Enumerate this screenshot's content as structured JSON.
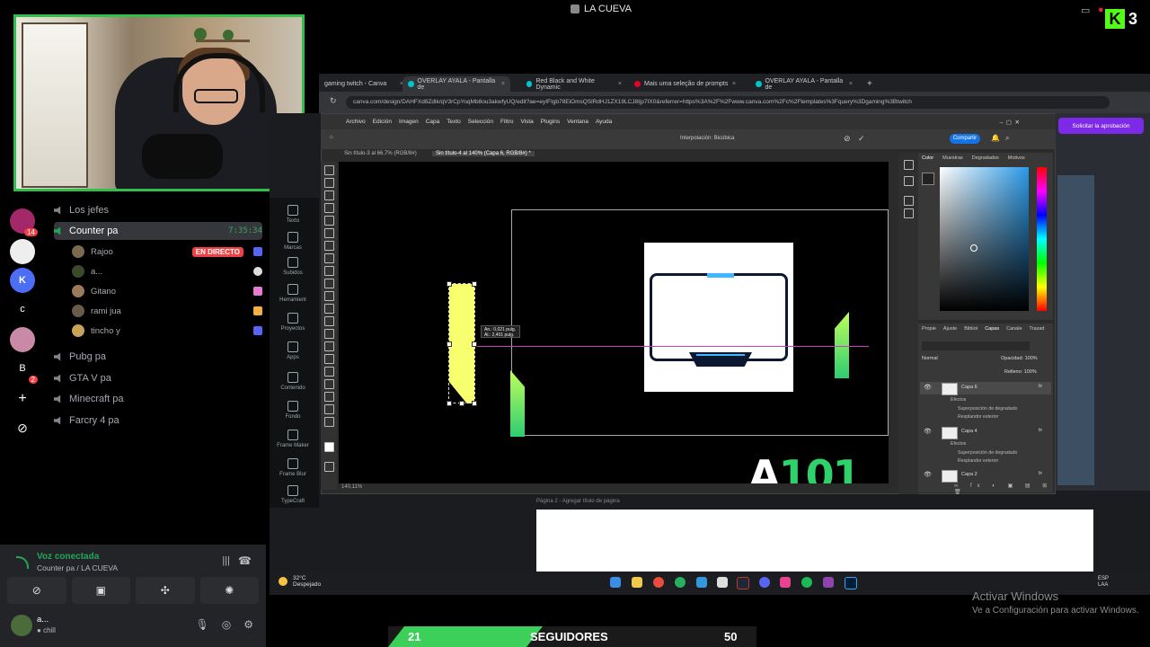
{
  "overlay": {
    "window_title": "LA CUEVA",
    "kick_viewers": "3",
    "followers": {
      "current": "21",
      "label": "SEGUIDORES",
      "goal": "50",
      "progress": 0.42
    }
  },
  "discord": {
    "channels": [
      {
        "name": "Los jefes"
      },
      {
        "name": "Counter pa",
        "time": "7:35:34"
      },
      {
        "name": "Pubg pa"
      },
      {
        "name": "GTA V pa"
      },
      {
        "name": "Minecraft pa"
      },
      {
        "name": "Farcry 4 pa"
      }
    ],
    "voice_users": [
      {
        "name": "Rajoo",
        "live": "EN DIRECTO"
      },
      {
        "name": "a..."
      },
      {
        "name": "Gitano"
      },
      {
        "name": "rami jua"
      },
      {
        "name": "tincho y"
      }
    ],
    "server_badges": {
      "s1": "14",
      "s7": "2"
    },
    "server_letters": {
      "c": "c",
      "b": "B"
    },
    "voice_panel": {
      "status": "Voz conectada",
      "location": "Counter pa / LA CUEVA",
      "user_name": "a...",
      "user_status": "chill"
    }
  },
  "browser": {
    "tabs": [
      "gaming twitch - Canva",
      "OVERLAY AYALA - Pantalla de",
      "Red Black and White Dynamic",
      "Mais uma seleção de prompts",
      "OVERLAY AYALA - Pantalla de"
    ],
    "url": "canva.com/design/DAHFXd8Zdlk/qV3rCpYoqMb8ou3akwfyUQ/edit?ae=eyIFIgb78EiOmsQSlRdHJ1ZX19LCJ8Ijp7IX0&referrer=https%3A%2F%2Fwww.canva.com%2Fc%2Ftemplates%3Fquery%3Dgaming%3Btwitch",
    "approve_button": "Solicitar la aprobación",
    "page2_label": "Página 2 - Agregar título de página"
  },
  "photoshop": {
    "menu": [
      "Archivo",
      "Edición",
      "Imagen",
      "Capa",
      "Texto",
      "Selección",
      "Filtro",
      "Vista",
      "Plugins",
      "Ventana",
      "Ayuda"
    ],
    "doc_tabs": [
      "Sin título-3 al 66,7% (RGB/8#)",
      "Sin título-4 al 140% (Capa 6, RGB/8#) *"
    ],
    "options_interp": "Interpolación: Bicúbica",
    "share_button": "Compartir",
    "status": "140,11%",
    "color_tabs": [
      "Color",
      "Muestras",
      "Degradados",
      "Motivos"
    ],
    "layer_tabs": [
      "Propie",
      "Ajuste",
      "Bibliot",
      "Capas",
      "Canale",
      "Trazad"
    ],
    "blend_mode": "Normal",
    "opacity": "Opacidad: 100%",
    "fill": "Relleno: 100%",
    "layers": [
      {
        "name": "Capa 6",
        "fx": "fx",
        "effects": [
          "Efectos",
          "Superposición de degradado",
          "Resplandor exterior"
        ]
      },
      {
        "name": "Capa 4",
        "fx": "fx",
        "effects": [
          "Efectos",
          "Superposición de degradado",
          "Resplandor exterior"
        ]
      },
      {
        "name": "Capa 2",
        "fx": "fx"
      }
    ],
    "measure": {
      "w": "An.: 0,021 pulg.",
      "h": "Al.: 2,401 pulg."
    },
    "canvas_logo": {
      "white": "A",
      "green": "101"
    }
  },
  "canva_sidebar": [
    "Texto",
    "Marcas",
    "Subidos",
    "Herramient",
    "Proyectos",
    "Apps",
    "Contenido",
    "Fondo",
    "Frame Maker",
    "Frame Blur",
    "TypeCraft"
  ],
  "taskbar": {
    "temp": "32°C",
    "weather": "Despejado",
    "lang": "ESP",
    "lang2": "LAA"
  },
  "activate_windows": {
    "title": "Activar Windows",
    "subtitle": "Ve a Configuración para activar Windows."
  }
}
